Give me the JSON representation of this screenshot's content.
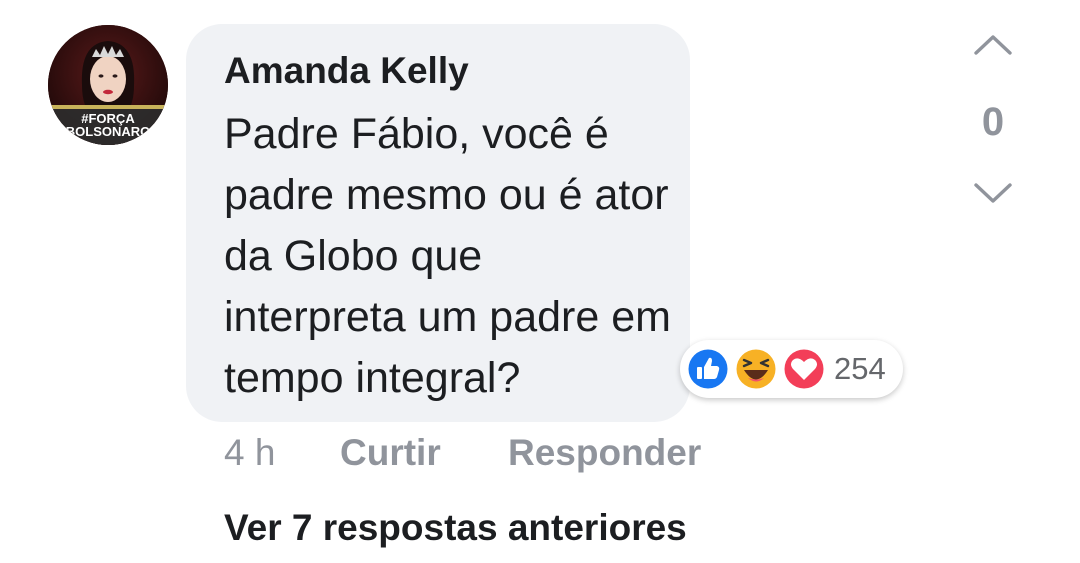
{
  "comment": {
    "author": "Amanda Kelly",
    "text": "Padre Fábio, você é padre mesmo ou é ator da Globo que interpreta um padre em tempo integral?",
    "avatar_overlay_line1": "#FORÇA",
    "avatar_overlay_line2": "BOLSONARO",
    "timestamp": "4 h",
    "like_label": "Curtir",
    "reply_label": "Responder",
    "reactions": {
      "icons": [
        "like-icon",
        "haha-icon",
        "love-icon"
      ],
      "count": "254"
    }
  },
  "vote": {
    "score": "0",
    "up_icon": "chevron-up-icon",
    "down_icon": "chevron-down-icon"
  },
  "more_replies_label": "Ver 7 respostas anteriores",
  "colors": {
    "bubble": "#f0f2f5",
    "text": "#1c1e21",
    "muted": "#90949c",
    "like_blue": "#1877f2",
    "love_red": "#f33e58",
    "haha_yellow": "#f7b125"
  }
}
